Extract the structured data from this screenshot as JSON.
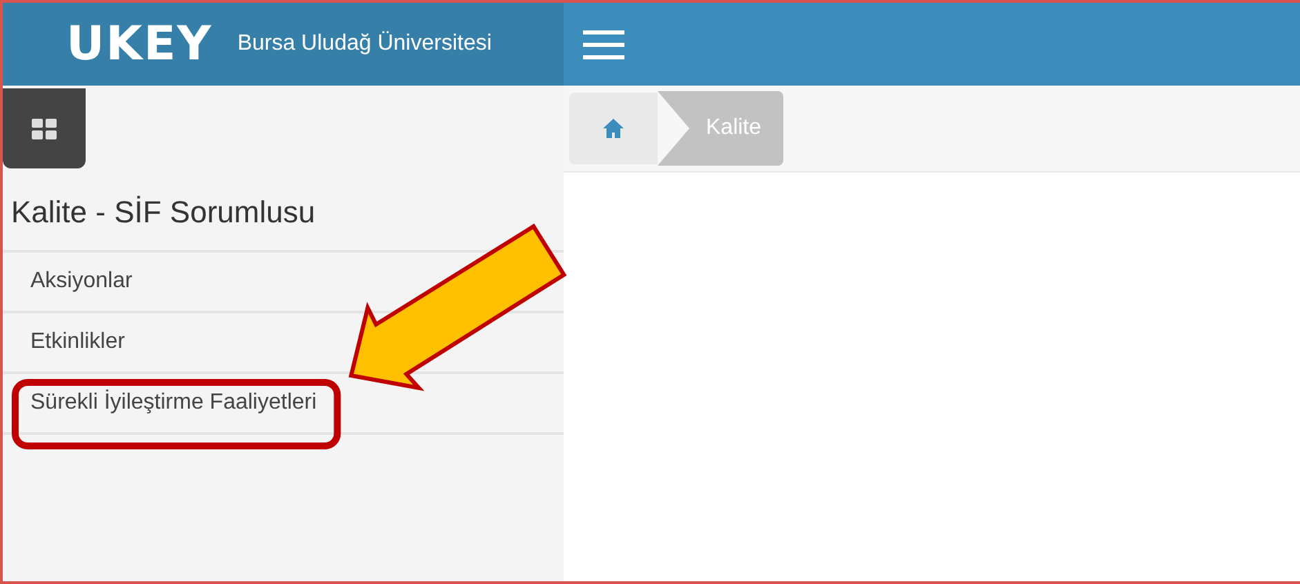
{
  "header": {
    "logo": "UKEY",
    "title": "Bursa Uludağ Üniversitesi"
  },
  "sidebar": {
    "title": "Kalite - SİF Sorumlusu",
    "items": [
      {
        "label": "Aksiyonlar",
        "highlighted": false
      },
      {
        "label": "Etkinlikler",
        "highlighted": false
      },
      {
        "label": "Sürekli İyileştirme Faaliyetleri",
        "highlighted": true
      }
    ]
  },
  "breadcrumb": [
    "Kalite"
  ]
}
